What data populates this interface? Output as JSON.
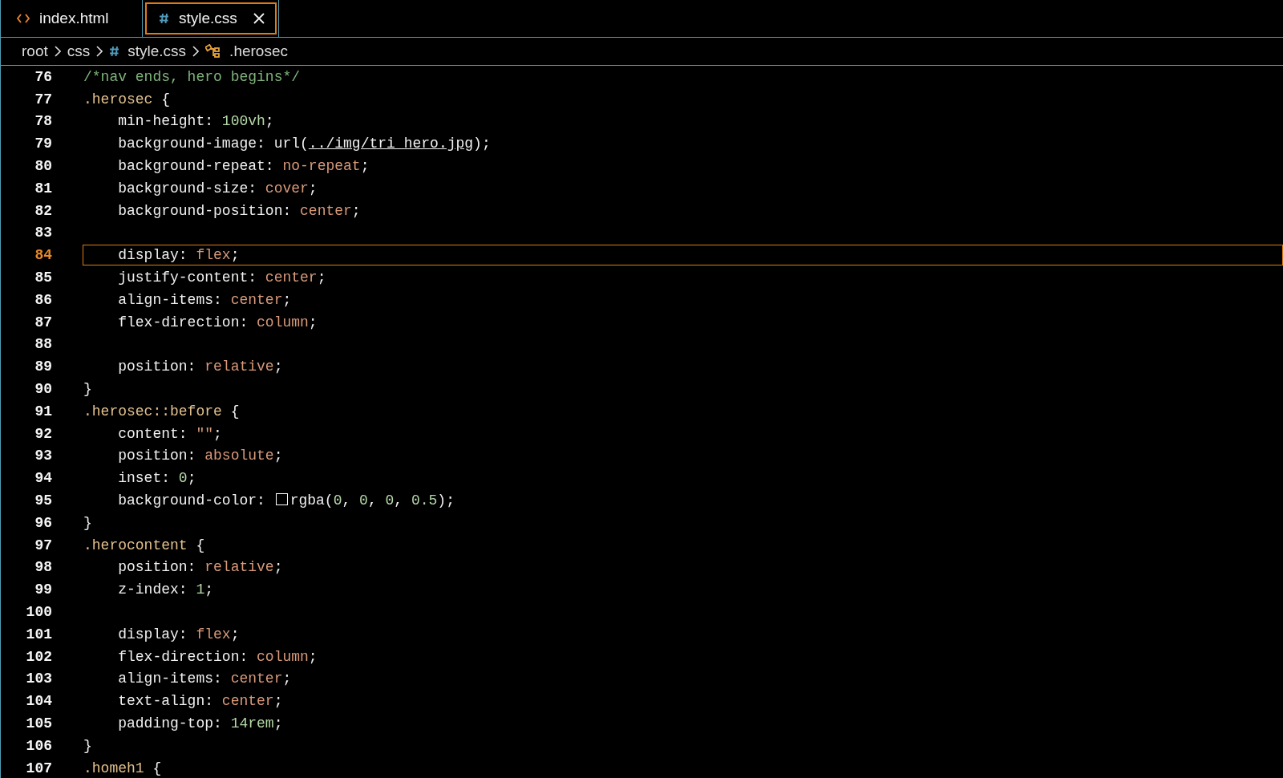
{
  "tabs": [
    {
      "label": "index.html",
      "kind": "html",
      "selected": false,
      "closable": false
    },
    {
      "label": "style.css",
      "kind": "css",
      "selected": true,
      "closable": true
    }
  ],
  "breadcrumb": [
    {
      "label": "root",
      "kind": "folder"
    },
    {
      "label": "css",
      "kind": "folder"
    },
    {
      "label": "style.css",
      "kind": "css"
    },
    {
      "label": ".herosec",
      "kind": "symbol"
    }
  ],
  "editor": {
    "lines": [
      {
        "number": "76",
        "current": false,
        "tokens": [
          {
            "kind": "comment",
            "text": "/*nav ends, hero begins*/"
          }
        ]
      },
      {
        "number": "77",
        "current": false,
        "tokens": [
          {
            "kind": "selector",
            "text": ".herosec"
          },
          {
            "kind": "punct",
            "text": " {"
          }
        ]
      },
      {
        "number": "78",
        "current": false,
        "tokens": [
          {
            "kind": "property",
            "text": "    min-height: "
          },
          {
            "kind": "number",
            "text": "100vh"
          },
          {
            "kind": "punct",
            "text": ";"
          }
        ]
      },
      {
        "number": "79",
        "current": false,
        "tokens": [
          {
            "kind": "property",
            "text": "    background-image: url("
          },
          {
            "kind": "link",
            "text": "../img/tri_hero.jpg"
          },
          {
            "kind": "punct",
            "text": ");"
          }
        ]
      },
      {
        "number": "80",
        "current": false,
        "tokens": [
          {
            "kind": "property",
            "text": "    background-repeat: "
          },
          {
            "kind": "value",
            "text": "no-repeat"
          },
          {
            "kind": "punct",
            "text": ";"
          }
        ]
      },
      {
        "number": "81",
        "current": false,
        "tokens": [
          {
            "kind": "property",
            "text": "    background-size: "
          },
          {
            "kind": "value",
            "text": "cover"
          },
          {
            "kind": "punct",
            "text": ";"
          }
        ]
      },
      {
        "number": "82",
        "current": false,
        "tokens": [
          {
            "kind": "property",
            "text": "    background-position: "
          },
          {
            "kind": "value",
            "text": "center"
          },
          {
            "kind": "punct",
            "text": ";"
          }
        ]
      },
      {
        "number": "83",
        "current": false
      },
      {
        "number": "84",
        "current": true,
        "tokens": [
          {
            "kind": "property",
            "text": "    display: "
          },
          {
            "kind": "value",
            "text": "flex"
          },
          {
            "kind": "punct",
            "text": ";"
          }
        ]
      },
      {
        "number": "85",
        "current": false,
        "tokens": [
          {
            "kind": "property",
            "text": "    justify-content: "
          },
          {
            "kind": "value",
            "text": "center"
          },
          {
            "kind": "punct",
            "text": ";"
          }
        ]
      },
      {
        "number": "86",
        "current": false,
        "tokens": [
          {
            "kind": "property",
            "text": "    align-items: "
          },
          {
            "kind": "value",
            "text": "center"
          },
          {
            "kind": "punct",
            "text": ";"
          }
        ]
      },
      {
        "number": "87",
        "current": false,
        "tokens": [
          {
            "kind": "property",
            "text": "    flex-direction: "
          },
          {
            "kind": "value",
            "text": "column"
          },
          {
            "kind": "punct",
            "text": ";"
          }
        ]
      },
      {
        "number": "88",
        "current": false
      },
      {
        "number": "89",
        "current": false,
        "tokens": [
          {
            "kind": "property",
            "text": "    position: "
          },
          {
            "kind": "value",
            "text": "relative"
          },
          {
            "kind": "punct",
            "text": ";"
          }
        ]
      },
      {
        "number": "90",
        "current": false,
        "tokens": [
          {
            "kind": "punct",
            "text": "}"
          }
        ]
      },
      {
        "number": "91",
        "current": false,
        "tokens": [
          {
            "kind": "selector",
            "text": ".herosec::before"
          },
          {
            "kind": "punct",
            "text": " {"
          }
        ]
      },
      {
        "number": "92",
        "current": false,
        "tokens": [
          {
            "kind": "property",
            "text": "    content: "
          },
          {
            "kind": "value",
            "text": "\"\""
          },
          {
            "kind": "punct",
            "text": ";"
          }
        ]
      },
      {
        "number": "93",
        "current": false,
        "tokens": [
          {
            "kind": "property",
            "text": "    position: "
          },
          {
            "kind": "value",
            "text": "absolute"
          },
          {
            "kind": "punct",
            "text": ";"
          }
        ]
      },
      {
        "number": "94",
        "current": false,
        "tokens": [
          {
            "kind": "property",
            "text": "    inset: "
          },
          {
            "kind": "number",
            "text": "0"
          },
          {
            "kind": "punct",
            "text": ";"
          }
        ]
      },
      {
        "number": "95",
        "current": false,
        "tokens": [
          {
            "kind": "property",
            "text": "    background-color: "
          },
          {
            "kind": "swatch",
            "color": "#000000"
          },
          {
            "kind": "punct",
            "text": "rgba("
          },
          {
            "kind": "number",
            "text": "0"
          },
          {
            "kind": "punct",
            "text": ", "
          },
          {
            "kind": "number",
            "text": "0"
          },
          {
            "kind": "punct",
            "text": ", "
          },
          {
            "kind": "number",
            "text": "0"
          },
          {
            "kind": "punct",
            "text": ", "
          },
          {
            "kind": "number",
            "text": "0.5"
          },
          {
            "kind": "punct",
            "text": ");"
          }
        ]
      },
      {
        "number": "96",
        "current": false,
        "tokens": [
          {
            "kind": "punct",
            "text": "}"
          }
        ]
      },
      {
        "number": "97",
        "current": false,
        "tokens": [
          {
            "kind": "selector",
            "text": ".herocontent"
          },
          {
            "kind": "punct",
            "text": " {"
          }
        ]
      },
      {
        "number": "98",
        "current": false,
        "tokens": [
          {
            "kind": "property",
            "text": "    position: "
          },
          {
            "kind": "value",
            "text": "relative"
          },
          {
            "kind": "punct",
            "text": ";"
          }
        ]
      },
      {
        "number": "99",
        "current": false,
        "tokens": [
          {
            "kind": "property",
            "text": "    z-index: "
          },
          {
            "kind": "number",
            "text": "1"
          },
          {
            "kind": "punct",
            "text": ";"
          }
        ]
      },
      {
        "number": "100",
        "current": false
      },
      {
        "number": "101",
        "current": false,
        "tokens": [
          {
            "kind": "property",
            "text": "    display: "
          },
          {
            "kind": "value",
            "text": "flex"
          },
          {
            "kind": "punct",
            "text": ";"
          }
        ]
      },
      {
        "number": "102",
        "current": false,
        "tokens": [
          {
            "kind": "property",
            "text": "    flex-direction: "
          },
          {
            "kind": "value",
            "text": "column"
          },
          {
            "kind": "punct",
            "text": ";"
          }
        ]
      },
      {
        "number": "103",
        "current": false,
        "tokens": [
          {
            "kind": "property",
            "text": "    align-items: "
          },
          {
            "kind": "value",
            "text": "center"
          },
          {
            "kind": "punct",
            "text": ";"
          }
        ]
      },
      {
        "number": "104",
        "current": false,
        "tokens": [
          {
            "kind": "property",
            "text": "    text-align: "
          },
          {
            "kind": "value",
            "text": "center"
          },
          {
            "kind": "punct",
            "text": ";"
          }
        ]
      },
      {
        "number": "105",
        "current": false,
        "tokens": [
          {
            "kind": "property",
            "text": "    padding-top: "
          },
          {
            "kind": "number",
            "text": "14rem"
          },
          {
            "kind": "punct",
            "text": ";"
          }
        ]
      },
      {
        "number": "106",
        "current": false,
        "tokens": [
          {
            "kind": "punct",
            "text": "}"
          }
        ]
      },
      {
        "number": "107",
        "current": false,
        "tokens": [
          {
            "kind": "selector",
            "text": ".homeh1"
          },
          {
            "kind": "punct",
            "text": " {"
          }
        ]
      }
    ]
  }
}
